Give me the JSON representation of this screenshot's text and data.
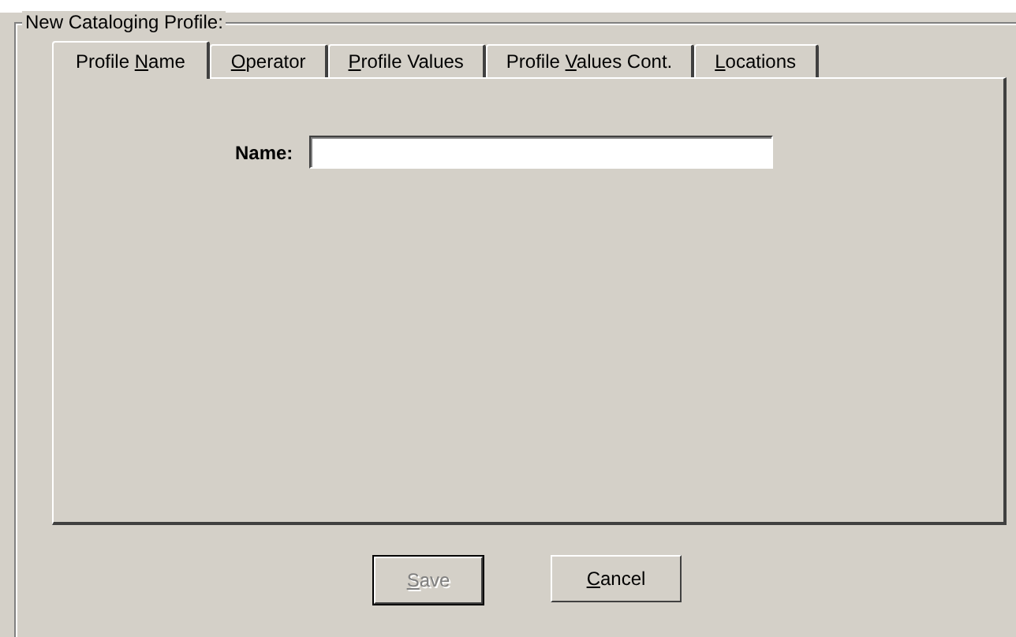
{
  "group": {
    "title": "New  Cataloging Profile:"
  },
  "tabs": [
    {
      "before": "Profile ",
      "key": "N",
      "after": "ame",
      "selected": true
    },
    {
      "key": "O",
      "after": "perator",
      "selected": false
    },
    {
      "key": "P",
      "after": "rofile Values",
      "selected": false
    },
    {
      "before": "Profile ",
      "key": "V",
      "after": "alues Cont.",
      "selected": false
    },
    {
      "key": "L",
      "after": "ocations",
      "selected": false
    }
  ],
  "name_field": {
    "label": "Name:"
  },
  "buttons": [
    {
      "key": "S",
      "after": "ave",
      "disabled": true,
      "default": true
    },
    {
      "key": "C",
      "after": "ancel",
      "disabled": false,
      "default": false
    }
  ]
}
